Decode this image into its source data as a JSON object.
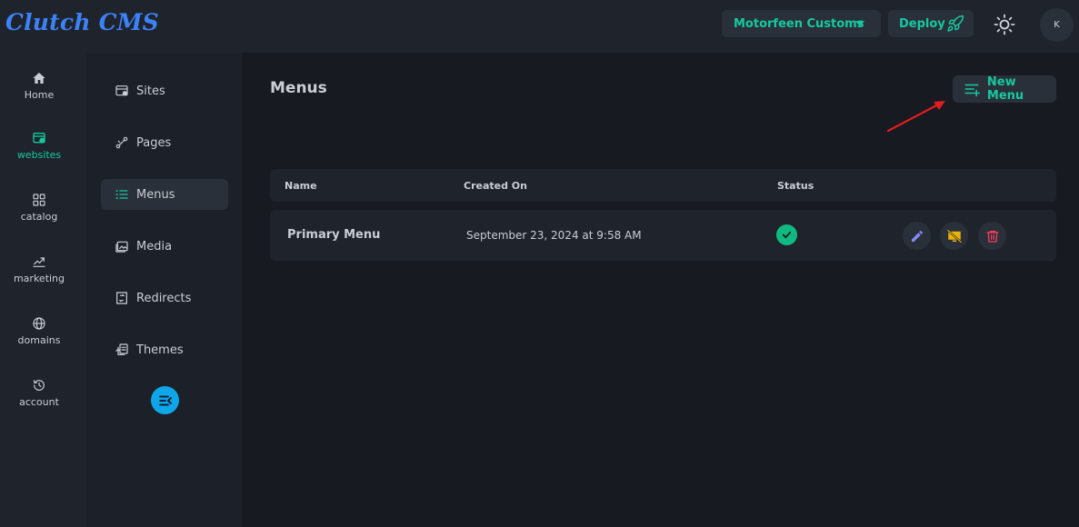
{
  "app": {
    "logo": "Clutch CMS"
  },
  "header": {
    "site_selector": "Motorfeen Customs",
    "deploy_label": "Deploy",
    "avatar_initial": "K"
  },
  "rail": {
    "items": [
      {
        "label": "Home",
        "icon": "home-icon"
      },
      {
        "label": "websites",
        "icon": "websites-icon"
      },
      {
        "label": "catalog",
        "icon": "catalog-icon"
      },
      {
        "label": "marketing",
        "icon": "marketing-icon"
      },
      {
        "label": "domains",
        "icon": "globe-icon"
      },
      {
        "label": "account",
        "icon": "history-icon"
      }
    ],
    "active": "websites"
  },
  "subnav": {
    "items": [
      {
        "label": "Sites",
        "icon": "sites-icon"
      },
      {
        "label": "Pages",
        "icon": "pages-icon"
      },
      {
        "label": "Menus",
        "icon": "menus-icon"
      },
      {
        "label": "Media",
        "icon": "media-icon"
      },
      {
        "label": "Redirects",
        "icon": "redirects-icon"
      },
      {
        "label": "Themes",
        "icon": "themes-icon"
      }
    ],
    "active": "Menus"
  },
  "main": {
    "title": "Menus",
    "new_menu_label": "New Menu",
    "table": {
      "columns": [
        "Name",
        "Created On",
        "Status"
      ],
      "rows": [
        {
          "name": "Primary Menu",
          "created_on": "September 23, 2024 at 9:58 AM",
          "status": "active"
        }
      ]
    }
  },
  "colors": {
    "accent": "#14c9a1",
    "logo": "#3b82f6",
    "status_ok": "#10b981",
    "edit": "#818cf8",
    "hide": "#eab308",
    "delete": "#f43f5e",
    "annotation_arrow": "#e11d1d"
  }
}
